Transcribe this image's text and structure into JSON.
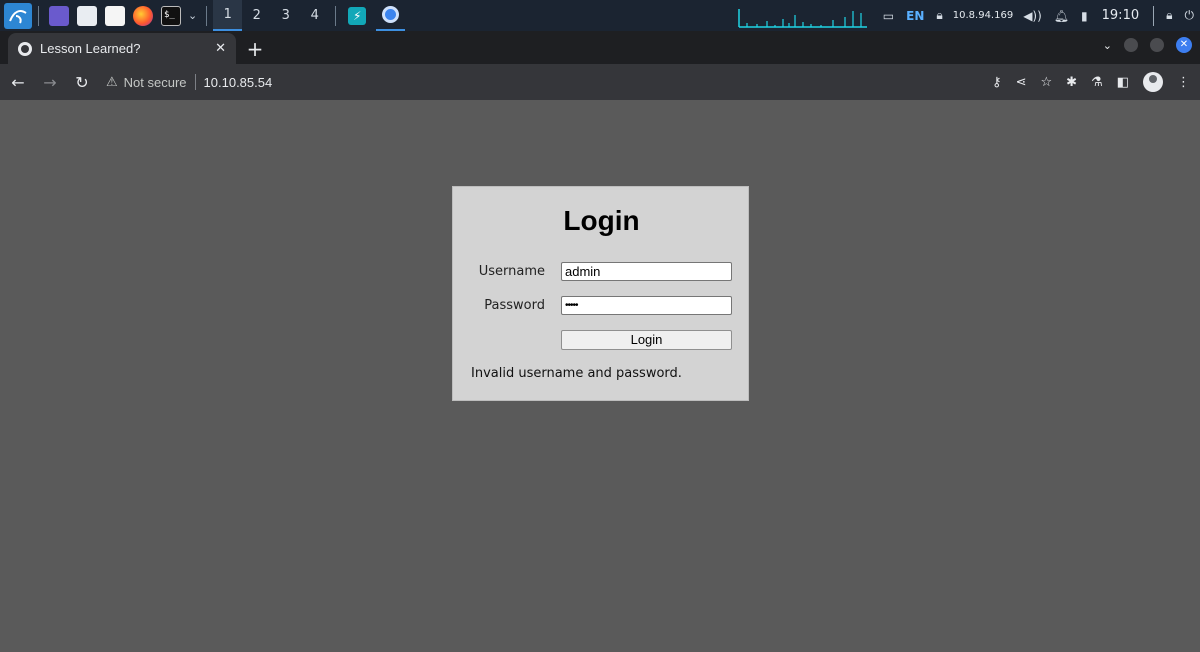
{
  "taskbar": {
    "terminal_label": "$_",
    "workspaces": [
      "1",
      "2",
      "3",
      "4"
    ],
    "active_workspace": "1",
    "keyboard_layout": "EN",
    "vpn_ip": "10.8.94.169",
    "clock": "19:10"
  },
  "browser": {
    "tab_title": "Lesson Learned?",
    "security_label": "Not secure",
    "url": "10.10.85.54",
    "accent_color": "#3d7ef0"
  },
  "page": {
    "background_color": "#5a5a5a",
    "login": {
      "title": "Login",
      "username_label": "Username",
      "username_value": "admin",
      "password_label": "Password",
      "password_mask": "•••••",
      "submit_label": "Login",
      "error_message": "Invalid username and password."
    }
  }
}
